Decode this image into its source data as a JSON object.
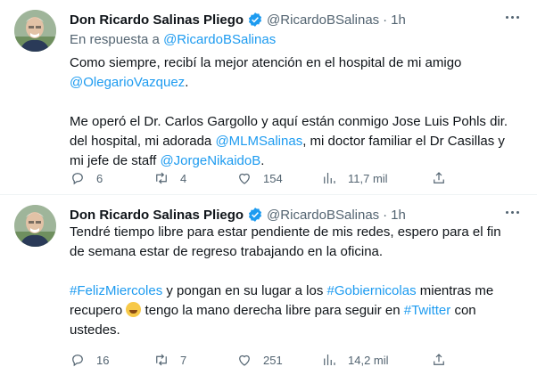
{
  "tweets": [
    {
      "author_name": "Don Ricardo Salinas Pliego",
      "handle": "@RicardoBSalinas",
      "dot": "·",
      "time": "1h",
      "reply_prefix": "En respuesta a",
      "reply_handle": "@RicardoBSalinas",
      "body": {
        "p1a": "Como siempre, recibí la mejor atención en el hospital de mi amigo",
        "p1_link": "@OlegarioVazquez",
        "p1b": ".",
        "p2a": "Me operó el Dr. Carlos Gargollo y aquí están conmigo Jose Luis Pohls dir. del hospital, mi adorada",
        "p2_link1": "@MLMSalinas",
        "p2b": ", mi doctor familiar el Dr Casillas y mi jefe de staff",
        "p2_link2": "@JorgeNikaidoB",
        "p2c": "."
      },
      "stats": {
        "replies": "6",
        "retweets": "4",
        "likes": "154",
        "views": "11,7 mil"
      }
    },
    {
      "author_name": "Don Ricardo Salinas Pliego",
      "handle": "@RicardoBSalinas",
      "dot": "·",
      "time": "1h",
      "body": {
        "p1": "Tendré tiempo libre para estar pendiente de mis redes, espero para el fin de semana estar de regreso trabajando en la oficina.",
        "hashtag1": "#FelizMiercoles",
        "p2a": "y pongan en su lugar a los",
        "hashtag2": "#Gobiernicolas",
        "p2b": "mientras me recupero",
        "p2c": "tengo la mano derecha libre para seguir en",
        "hashtag3": "#Twitter",
        "p2d": "con ustedes."
      },
      "emoji_name": "tears-of-joy-emoji",
      "stats": {
        "replies": "16",
        "retweets": "7",
        "likes": "251",
        "views": "14,2 mil"
      }
    }
  ],
  "colors": {
    "link": "#1d9bf0",
    "text": "#0f1419",
    "muted": "#536471",
    "verified": "#1d9bf0"
  }
}
